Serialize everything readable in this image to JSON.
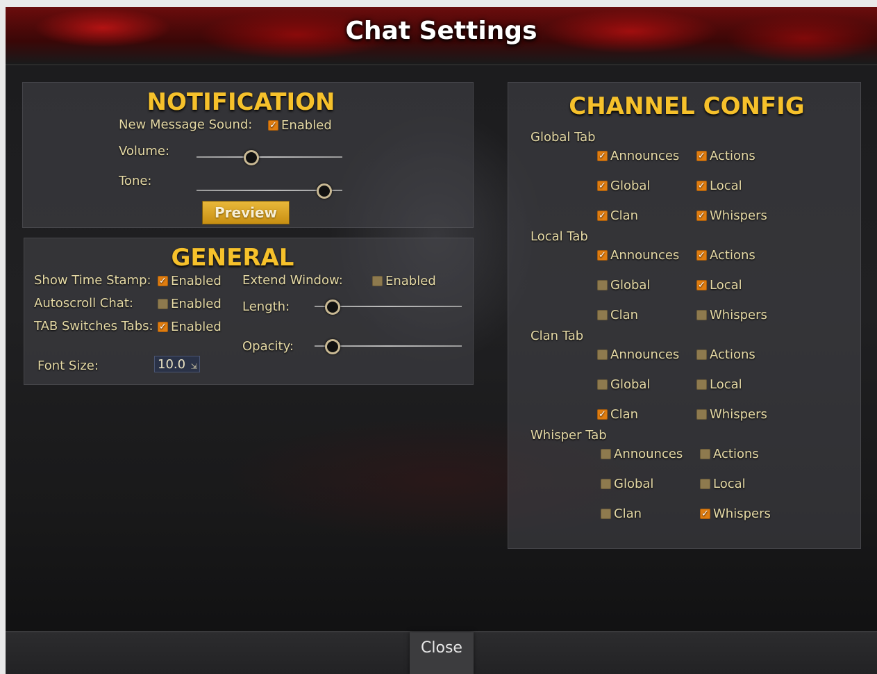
{
  "window": {
    "title": "Chat Settings"
  },
  "notification": {
    "heading": "NOTIFICATION",
    "new_message_sound_label": "New Message Sound:",
    "new_message_sound": {
      "label": "Enabled",
      "checked": true
    },
    "volume_label": "Volume:",
    "volume_level": 0.37,
    "tone_label": "Tone:",
    "tone_level": 0.87,
    "preview_label": "Preview"
  },
  "general": {
    "heading": "GENERAL",
    "show_time_stamp_label": "Show Time Stamp:",
    "show_time_stamp": {
      "label": "Enabled",
      "checked": true
    },
    "autoscroll_label": "Autoscroll Chat:",
    "autoscroll": {
      "label": "Enabled",
      "checked": false
    },
    "tab_switches_label": "TAB Switches Tabs:",
    "tab_switches": {
      "label": "Enabled",
      "checked": true
    },
    "extend_window_label": "Extend Window:",
    "extend_window": {
      "label": "Enabled",
      "checked": false
    },
    "length_label": "Length:",
    "length_level": 0.12,
    "opacity_label": "Opacity:",
    "opacity_level": 0.12,
    "font_size_label": "Font Size:",
    "font_size_value": "10.0"
  },
  "channel_config": {
    "heading": "CHANNEL CONFIG",
    "tabs": [
      {
        "name": "Global Tab",
        "channels": [
          {
            "label": "Announces",
            "checked": true
          },
          {
            "label": "Actions",
            "checked": true
          },
          {
            "label": "Global",
            "checked": true
          },
          {
            "label": "Local",
            "checked": true
          },
          {
            "label": "Clan",
            "checked": true
          },
          {
            "label": "Whispers",
            "checked": true
          }
        ]
      },
      {
        "name": "Local Tab",
        "channels": [
          {
            "label": "Announces",
            "checked": true
          },
          {
            "label": "Actions",
            "checked": true
          },
          {
            "label": "Global",
            "checked": false
          },
          {
            "label": "Local",
            "checked": true
          },
          {
            "label": "Clan",
            "checked": false
          },
          {
            "label": "Whispers",
            "checked": false
          }
        ]
      },
      {
        "name": "Clan Tab",
        "channels": [
          {
            "label": "Announces",
            "checked": false
          },
          {
            "label": "Actions",
            "checked": false
          },
          {
            "label": "Global",
            "checked": false
          },
          {
            "label": "Local",
            "checked": false
          },
          {
            "label": "Clan",
            "checked": true
          },
          {
            "label": "Whispers",
            "checked": false
          }
        ]
      },
      {
        "name": "Whisper Tab",
        "channels": [
          {
            "label": "Announces",
            "checked": false
          },
          {
            "label": "Actions",
            "checked": false
          },
          {
            "label": "Global",
            "checked": false
          },
          {
            "label": "Local",
            "checked": false
          },
          {
            "label": "Clan",
            "checked": false
          },
          {
            "label": "Whispers",
            "checked": true
          }
        ]
      }
    ]
  },
  "footer": {
    "close_label": "Close"
  },
  "colors": {
    "accent_gold": "#f6c12b",
    "label_text": "#e5d9a5",
    "checkbox_checked": "#e07d10",
    "checkbox_unchecked": "#8e7a4e"
  }
}
